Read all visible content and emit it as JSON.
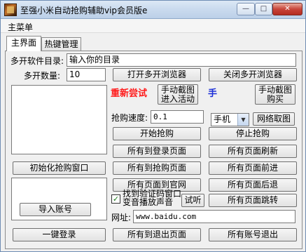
{
  "window": {
    "title": "至强小米自动抢购辅助vip会员版e",
    "min_glyph": "—",
    "max_glyph": "□",
    "close_glyph": "✕"
  },
  "menu": {
    "main": "主菜单"
  },
  "tabs": {
    "main": "主界面",
    "hotkeys": "热键管理"
  },
  "fields": {
    "dir_label": "多开软件目录:",
    "dir_value": "输入你的目录",
    "count_label": "多开数量:",
    "count_value": "10",
    "speed_label": "抢购速度:",
    "speed_value": "0.1",
    "url_label": "网址:",
    "url_value": "www.baidu.com"
  },
  "status": {
    "retry": "重新尝试",
    "hand": "手"
  },
  "select": {
    "device": "手机"
  },
  "checkbox": {
    "label_line1": "找到验证码窗口",
    "label_line2": "变音播放声音",
    "checked_mark": "✓"
  },
  "buttons": {
    "open_browser": "打开多开浏览器",
    "close_browser": "关闭多开浏览器",
    "screenshot_enter_l1": "手动截图",
    "screenshot_enter_l2": "进入活动",
    "screenshot_buy_l1": "手动截图",
    "screenshot_buy_l2": "购买",
    "net_capture": "网络取图",
    "start_buy": "开始抢购",
    "stop_buy": "停止抢购",
    "all_login": "所有到登录页面",
    "all_refresh": "所有页面刷新",
    "init_window": "初始化抢购窗口",
    "all_buy_page": "所有到抢购页面",
    "all_forward": "所有页面前进",
    "all_official": "所有页面到官网",
    "all_back": "所有页面后退",
    "test_listen": "试听",
    "all_jump": "所有页面跳转",
    "import_account": "导入账号",
    "one_login": "一键登录",
    "all_logout_page": "所有到退出页面",
    "all_account_logout": "所有账号退出"
  }
}
